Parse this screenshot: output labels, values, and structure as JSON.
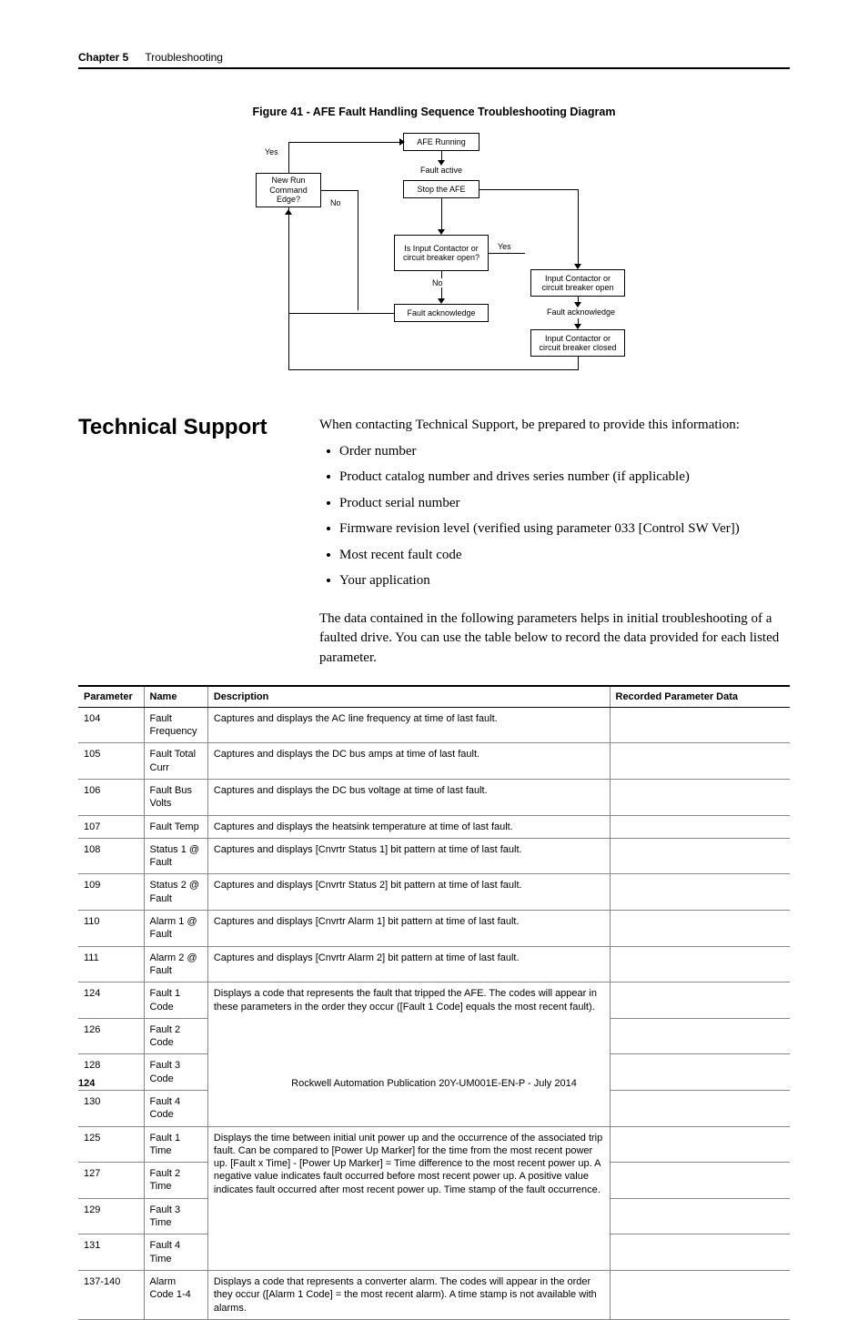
{
  "header": {
    "chapter_label": "Chapter 5",
    "chapter_title": "Troubleshooting"
  },
  "figure": {
    "title": "Figure 41 - AFE Fault Handling Sequence Troubleshooting Diagram",
    "nodes": {
      "afe_running": "AFE Running",
      "fault_active": "Fault active",
      "stop_afe": "Stop the AFE",
      "new_run_cmd": "New Run Command Edge?",
      "input_contactor_q": "Is Input Contactor or circuit breaker open?",
      "fault_ack_left": "Fault acknowledge",
      "fault_ack_right": "Fault acknowledge",
      "ic_open": "Input Contactor or circuit breaker open",
      "ic_closed": "Input Contactor or circuit breaker closed"
    },
    "labels": {
      "yes1": "Yes",
      "no1": "No",
      "yes2": "Yes",
      "no2": "No"
    }
  },
  "section": {
    "heading": "Technical Support",
    "intro": "When contacting Technical Support, be prepared to provide this information:",
    "bullets": [
      "Order number",
      "Product catalog number and drives series number (if applicable)",
      "Product serial number",
      "Firmware revision level (verified using parameter 033 [Control SW Ver])",
      "Most recent fault code",
      "Your application"
    ],
    "para": "The data contained in the following parameters helps in initial troubleshooting of a faulted drive. You can use the table below to record the data provided for each listed parameter."
  },
  "table": {
    "headers": {
      "parameter": "Parameter",
      "name": "Name",
      "description": "Description",
      "recorded": "Recorded Parameter Data"
    },
    "rows": [
      {
        "p": "104",
        "n": "Fault Frequency",
        "d": "Captures and displays the AC line frequency at time of last fault."
      },
      {
        "p": "105",
        "n": "Fault Total Curr",
        "d": "Captures and displays the DC bus amps at time of last fault."
      },
      {
        "p": "106",
        "n": "Fault Bus Volts",
        "d": "Captures and displays the DC bus voltage at time of last fault."
      },
      {
        "p": "107",
        "n": "Fault Temp",
        "d": "Captures and displays the heatsink temperature at time of last fault."
      },
      {
        "p": "108",
        "n": "Status 1 @ Fault",
        "d": "Captures and displays [Cnvrtr Status 1] bit pattern at time of last fault."
      },
      {
        "p": "109",
        "n": "Status 2 @ Fault",
        "d": "Captures and displays [Cnvrtr Status 2] bit pattern at time of last fault."
      },
      {
        "p": "110",
        "n": "Alarm 1 @ Fault",
        "d": "Captures and displays [Cnvrtr Alarm 1] bit pattern at time of last fault."
      },
      {
        "p": "111",
        "n": "Alarm 2 @ Fault",
        "d": "Captures and displays [Cnvrtr Alarm 2] bit pattern at time of last fault."
      }
    ],
    "fault_code_desc": "Displays a code that represents the fault that tripped the AFE. The codes will appear in these parameters in the order they occur ([Fault 1 Code] equals the most recent fault).",
    "fault_code_rows": [
      {
        "p": "124",
        "n": "Fault 1 Code"
      },
      {
        "p": "126",
        "n": "Fault 2 Code"
      },
      {
        "p": "128",
        "n": "Fault 3 Code"
      },
      {
        "p": "130",
        "n": "Fault 4 Code"
      }
    ],
    "fault_time_desc": "Displays the time between initial unit power up and the occurrence of the associated trip fault. Can be compared to [Power Up Marker] for the time from the most recent power up. [Fault x Time] - [Power Up Marker] = Time difference to the most recent power up. A negative value indicates fault occurred before most recent power up. A positive value indicates fault occurred after most recent power up. Time stamp of the fault occurrence.",
    "fault_time_rows": [
      {
        "p": "125",
        "n": "Fault 1 Time"
      },
      {
        "p": "127",
        "n": "Fault 2 Time"
      },
      {
        "p": "129",
        "n": "Fault 3 Time"
      },
      {
        "p": "131",
        "n": "Fault 4 Time"
      }
    ],
    "alarm_row": {
      "p": "137-140",
      "n": "Alarm Code 1-4",
      "d": "Displays a code that represents a converter alarm. The codes will appear in the order they occur ([Alarm 1 Code] = the most recent alarm). A time stamp is not available with alarms."
    }
  },
  "footer": {
    "page": "124",
    "pub": "Rockwell Automation Publication 20Y-UM001E-EN-P - July 2014"
  }
}
